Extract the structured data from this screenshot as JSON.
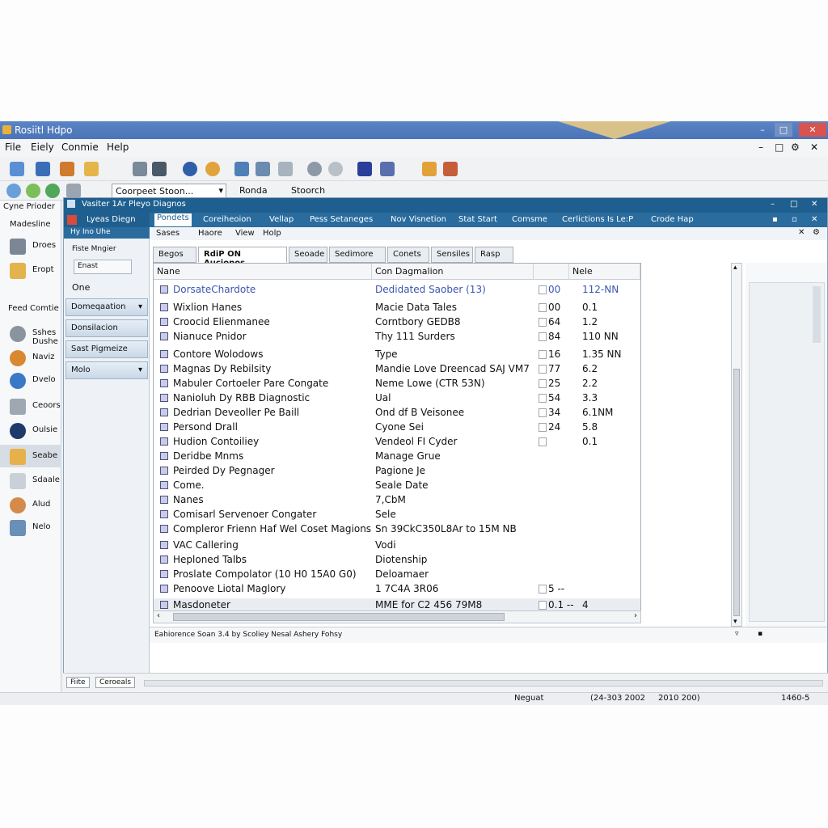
{
  "outer": {
    "title": "Rosiitl Hdpo",
    "menu": [
      "File",
      "Eiely",
      "Conmie",
      "Help"
    ],
    "combo_text": "Coorpeet Stoon...",
    "toolbar_labels": [
      "Ronda",
      "Stoorch"
    ],
    "left_header": "Cyne Prioder",
    "left_items": [
      "Madesline",
      "Droes",
      "Eropt",
      "Feed Comtie",
      "Sshes Dushe",
      "Naviz",
      "Dvelo",
      "Ceoors",
      "Oulsie",
      "Seabe",
      "Sdaale",
      "Alud",
      "Nelo"
    ]
  },
  "inner": {
    "title": "Vasiter 1Ar Pleyo Diagnos",
    "nav_tabs": [
      "Pondets",
      "Coreiheoion",
      "Vellap",
      "Pess Setaneges",
      "Nov Visnetion",
      "Stat Start",
      "Comsme",
      "Cerlictions Is Le:P",
      "Crode Hap"
    ],
    "menu": [
      "Sases",
      "Haore",
      "View",
      "Holp"
    ],
    "side_header": "Lyeas Diegn",
    "side_sub": "Hy Ino Uhe",
    "side_sub2": "Fiste Mngier",
    "side_field": "Enast",
    "side_label": "One",
    "side_buttons": [
      "Domeqaation",
      "Donsilacion",
      "Sast Pigmeize",
      "Molo"
    ],
    "tabs": [
      "Begos",
      "RdiP ON Aucionos",
      "Seoade",
      "Sedimore",
      "Conets",
      "Sensiles",
      "Rasp"
    ],
    "columns": [
      "Nane",
      "Con Dagmalion",
      "",
      "Nele"
    ],
    "rows": [
      {
        "name": "DorsateChardote",
        "desc": "Dedidated Saober (13)",
        "v1": "00",
        "v2": "112-NN"
      },
      {
        "name": "Wixlion Hanes",
        "desc": "Macie Data Tales",
        "v1": "00",
        "v2": "0.1"
      },
      {
        "name": "Croocid Elienmanee",
        "desc": "Corntbory GEDB8",
        "v1": "64",
        "v2": "1.2"
      },
      {
        "name": "Nianuce Pnidor",
        "desc": "Thy 111 Surders",
        "v1": "84",
        "v2": "110 NN"
      },
      {
        "name": "Contore Wolodows",
        "desc": "Type",
        "v1": "16",
        "v2": "1.35 NN"
      },
      {
        "name": "Magnas Dy Rebilsity",
        "desc": "Mandie Love Dreencad SAJ VM7",
        "v1": "77",
        "v2": "6.2"
      },
      {
        "name": "Mabuler Cortoeler Pare Congate",
        "desc": "Neme Lowe (CTR 53N)",
        "v1": "25",
        "v2": "2.2"
      },
      {
        "name": "Nanioluh Dy RBB Diagnostic",
        "desc": "Ual",
        "v1": "54",
        "v2": "3.3"
      },
      {
        "name": "Dedrian Deveoller Pe Baill",
        "desc": "Ond df B Veisonee",
        "v1": "34",
        "v2": "6.1NM"
      },
      {
        "name": "Persond Drall",
        "desc": "Cyone Sei",
        "v1": "24",
        "v2": "5.8"
      },
      {
        "name": "Hudion Contoiliey",
        "desc": "Vendeol FI Cyder",
        "v1": "",
        "v2": "0.1"
      },
      {
        "name": "Deridbe Mnms",
        "desc": "Manage Grue",
        "v1": "",
        "v2": ""
      },
      {
        "name": "Peirded Dy Pegnager",
        "desc": "Pagione Je",
        "v1": "",
        "v2": ""
      },
      {
        "name": "Come.",
        "desc": "Seale Date",
        "v1": "",
        "v2": ""
      },
      {
        "name": "Nanes",
        "desc": "7,CbM",
        "v1": "",
        "v2": ""
      },
      {
        "name": "Comisarl Servenoer Congater",
        "desc": "Sele",
        "v1": "",
        "v2": ""
      },
      {
        "name": "Compleror Frienn Haf Wel Coset Magions",
        "desc": "Sn 39CkC350L8Ar to 15M NB",
        "v1": "",
        "v2": ""
      },
      {
        "name": "VAC Callering",
        "desc": "Vodi",
        "v1": "",
        "v2": ""
      },
      {
        "name": "Heploned Talbs",
        "desc": "Diotenship",
        "v1": "",
        "v2": ""
      },
      {
        "name": "Proslate Compolator (10 H0 15A0 G0)",
        "desc": "Deloamaer",
        "v1": "",
        "v2": ""
      },
      {
        "name": "Penoove Liotal Maglory",
        "desc": "1 7C4A 3R06",
        "v1": "5 --",
        "v2": ""
      },
      {
        "name": "Masdoneter",
        "desc": "MME for C2 456 79M8",
        "v1": "0.1 --",
        "v2": "4"
      }
    ],
    "status": "Eahiorence Soan 3.4 by Scoliey Nesal Ashery Fohsy"
  },
  "bottom_buttons": [
    "Fiite",
    "Ceroeals"
  ],
  "status_bar": [
    "Neguat",
    "(24-303 2002",
    "2010 200)",
    "1460-5"
  ]
}
